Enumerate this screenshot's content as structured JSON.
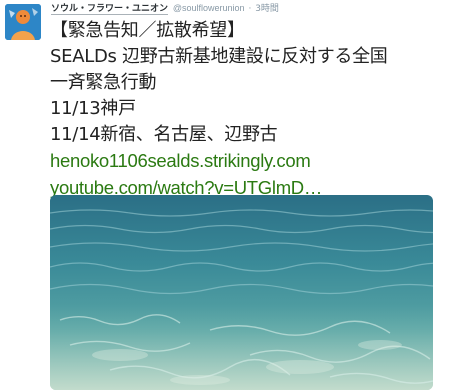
{
  "tweet": {
    "display_name": "ソウル・フラワー・ユニオン",
    "handle": "@soulflowerunion",
    "separator": "·",
    "time": "3時間",
    "text_lines": [
      "【緊急告知／拡散希望】",
      "SEALDs 辺野古新基地建設に反対する全国",
      "一斉緊急行動",
      "11/13神戸",
      "11/14新宿、名古屋、辺野古"
    ],
    "links": [
      "henoko1106sealds.strikingly.com",
      "youtube.com/watch?v=UTGlmD…"
    ],
    "colors": {
      "link": "#2b7a12",
      "text": "#222222",
      "meta": "#8899a6",
      "avatar_bg": "#2d86c7"
    },
    "avatar_icon": "user-avatar",
    "media_icon": "ocean-photo"
  }
}
